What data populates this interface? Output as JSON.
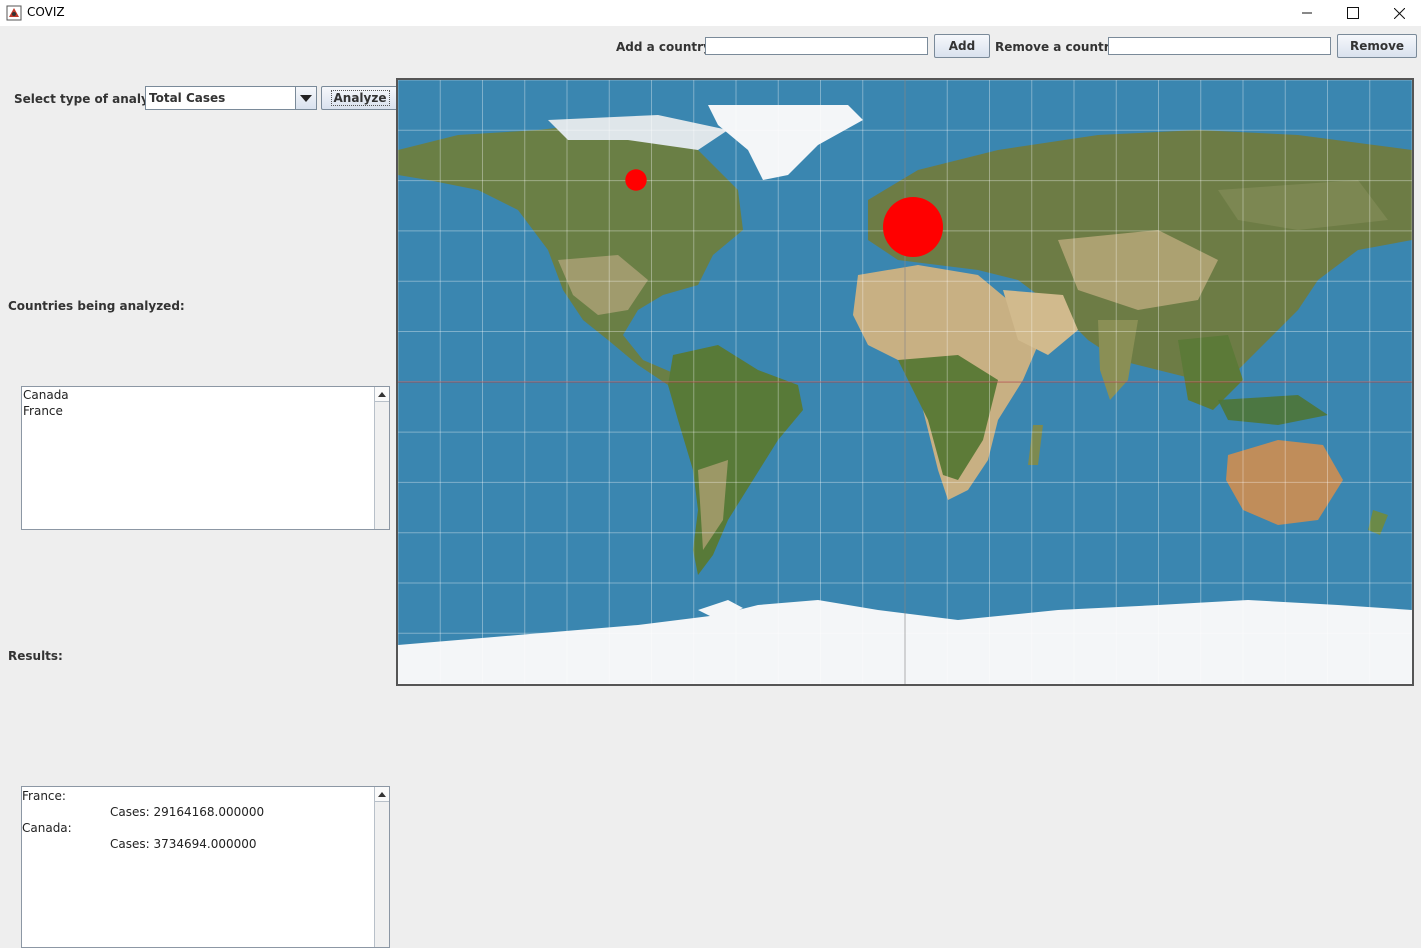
{
  "window": {
    "title": "COVIZ"
  },
  "toolbar": {
    "add_label": "Add a country:",
    "add_value": "",
    "add_button": "Add",
    "remove_label": "Remove a country:",
    "remove_value": "",
    "remove_button": "Remove"
  },
  "analysis": {
    "label": "Select type of analysis",
    "selected": "Total Cases",
    "button": "Analyze"
  },
  "countries": {
    "label": "Countries being analyzed:",
    "items": [
      "Canada",
      "France"
    ]
  },
  "results": {
    "label": "Results:",
    "entries": [
      {
        "country": "France:",
        "detail": "Cases: 29164168.000000"
      },
      {
        "country": "Canada:",
        "detail": "Cases: 3734694.000000"
      }
    ]
  },
  "map": {
    "markers": [
      {
        "country": "Canada",
        "cases": 3734694,
        "color": "#ff0000"
      },
      {
        "country": "France",
        "cases": 29164168,
        "color": "#ff0000"
      }
    ],
    "ocean_color": "#3a86b0",
    "land_color": "#5f7a3c",
    "ice_color": "#f4f6f8"
  }
}
